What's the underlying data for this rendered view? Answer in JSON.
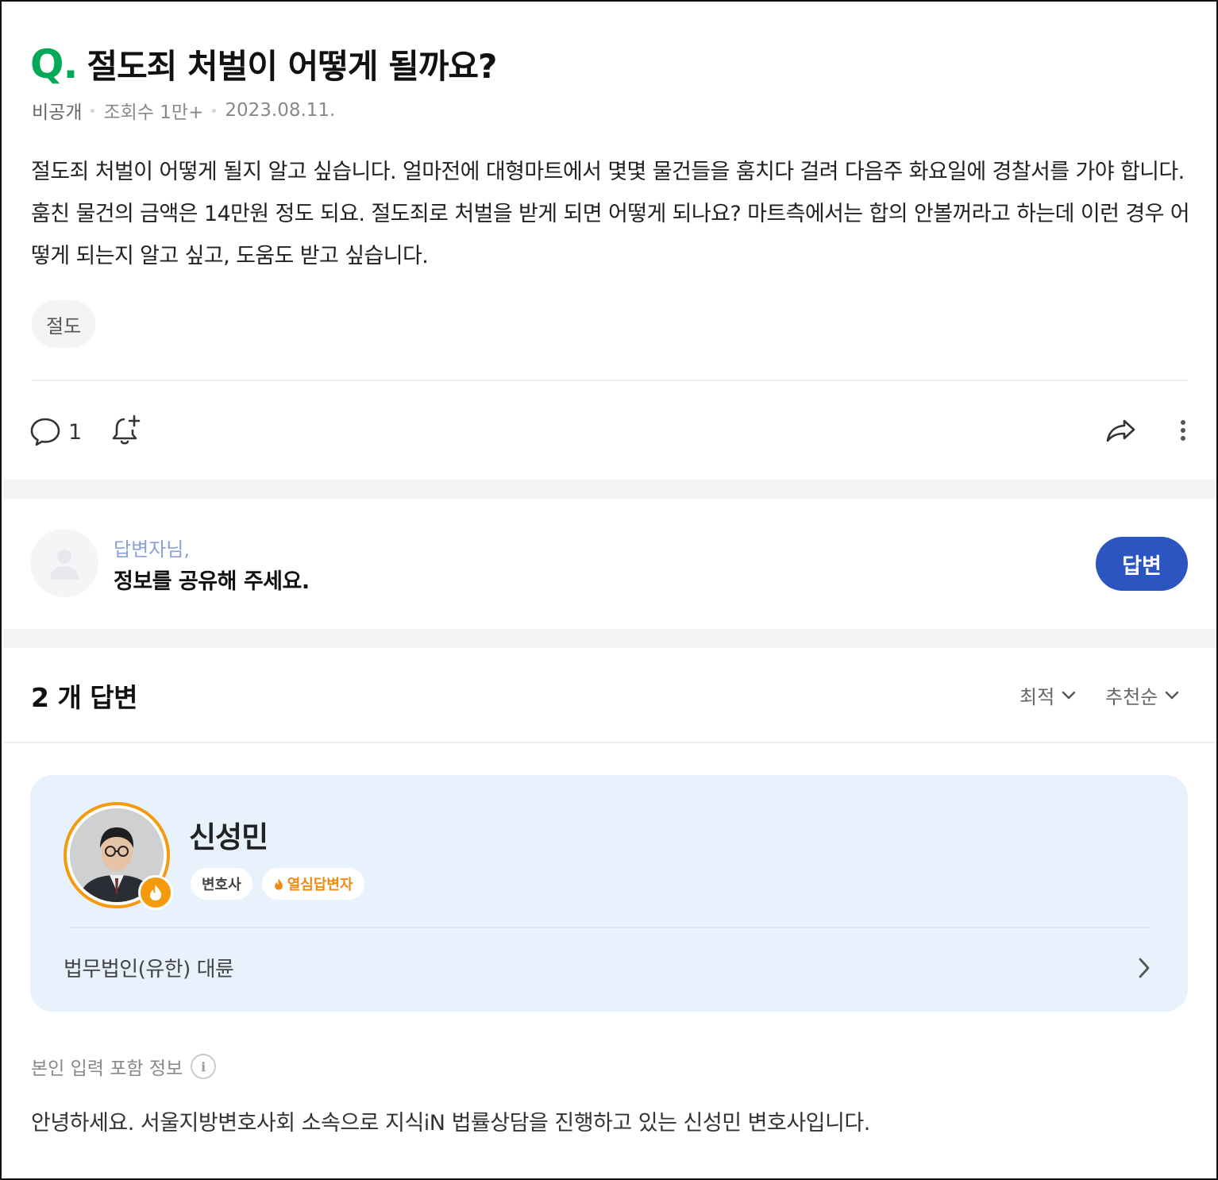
{
  "question": {
    "mark": "Q.",
    "title": "절도죄 처벌이 어떻게 될까요?",
    "author": "비공개",
    "views": "조회수 1만+",
    "date": "2023.08.11.",
    "body": "절도죄 처벌이 어떻게 될지 알고 싶습니다. 얼마전에 대형마트에서 몇몇 물건들을 훔치다 걸려 다음주 화요일에 경찰서를 가야 합니다. 훔친 물건의 금액은 14만원 정도 되요. 절도죄로 처벌을 받게 되면 어떻게 되나요? 마트측에서는 합의 안볼꺼라고 하는데 이런 경우 어떻게 되는지 알고 싶고, 도움도 받고 싶습니다.",
    "tag": "절도",
    "comment_count": "1"
  },
  "prompt": {
    "sub": "답변자님,",
    "main": "정보를 공유해 주세요.",
    "button": "답변"
  },
  "answers": {
    "count_label": "2 개 답변",
    "sort_latest": "최적",
    "sort_recommend": "추천순"
  },
  "answer_card": {
    "name": "신성민",
    "badge_role": "변호사",
    "badge_hot": "열심답변자",
    "firm": "법무법인(유한) 대륜",
    "self_info": "본인 입력 포함 정보",
    "info_glyph": "i",
    "body": "안녕하세요. 서울지방변호사회 소속으로 지식iN 법률상담을 진행하고 있는 신성민 변호사입니다."
  },
  "colors": {
    "accent_green": "#03a957",
    "button_blue": "#2d55c0",
    "card_bg": "#e7f2fd",
    "badge_orange": "#f59a0c"
  },
  "icons": [
    "comment-icon",
    "bell-plus-icon",
    "share-icon",
    "more-vertical-icon",
    "user-placeholder-icon",
    "chevron-down-icon",
    "chevron-right-icon",
    "fire-icon",
    "info-icon"
  ]
}
